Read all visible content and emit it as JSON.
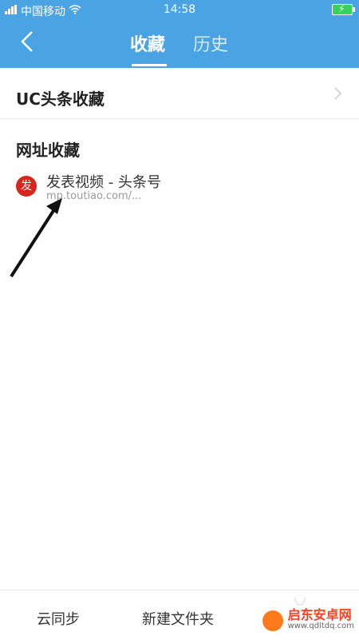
{
  "status": {
    "carrier": "中国移动",
    "time": "14:58"
  },
  "nav": {
    "tab_active": "收藏",
    "tab_inactive": "历史"
  },
  "uc_row": {
    "label": "UC头条收藏"
  },
  "section": {
    "title": "网址收藏"
  },
  "bookmark": {
    "favicon_text": "发",
    "title": "发表视频 - 头条号",
    "url": "mp.toutiao.com/..."
  },
  "bottom": {
    "sync": "云同步",
    "new_folder": "新建文件夹"
  },
  "watermark": {
    "name": "启东安卓网",
    "site": "www.qdltdq.com"
  },
  "colors": {
    "accent": "#4aa4e3",
    "favicon_red": "#d8261c"
  }
}
